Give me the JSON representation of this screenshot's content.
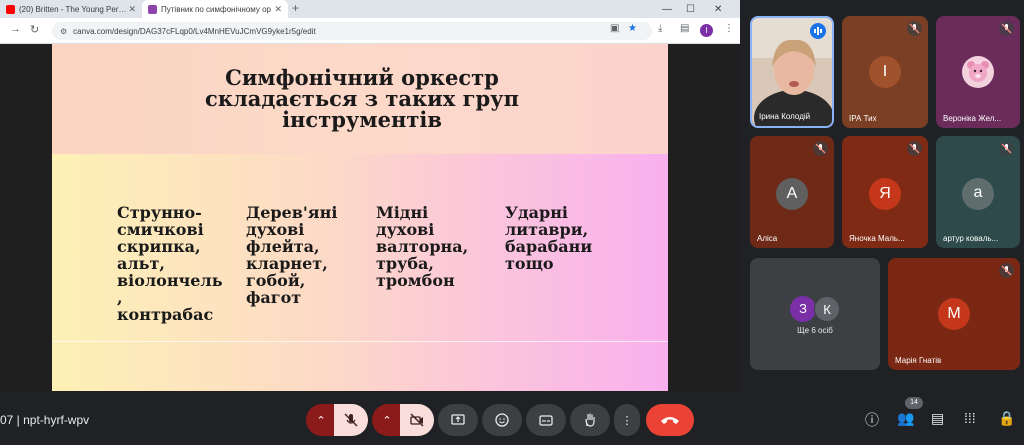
{
  "browser": {
    "tabs": [
      {
        "label": "(20) Britten - The Young Person's",
        "favicon_color": "#ff0000"
      },
      {
        "label": "Путівник по симфонічному ор",
        "favicon_color": "#8e44ad"
      }
    ],
    "new_tab": "+",
    "url": "canva.com/design/DAG37cFLqp0/Lv4MnHEVuJCmVG9yke1r5g/edit",
    "profile_initial": "I"
  },
  "slide": {
    "title": "Симфонічний оркестр складається з таких груп інструментів",
    "columns": [
      {
        "text": "Струнно-\nсмичкові\nскрипка,\nальт,\nвіолончель\n,\nконтрабас"
      },
      {
        "text": "Дерев'яні\nдухові\nфлейта,\nкларнет,\nгобой,\nфагот"
      },
      {
        "text": "Мідні\nдухові\nвалторна,\nтруба,\nтромбон"
      },
      {
        "text": "Ударні\nлитаври,\nбарабани\nтощо"
      }
    ]
  },
  "participants": [
    {
      "name": "Ірина Колодій",
      "type": "video"
    },
    {
      "name": "ІРА Тих",
      "initial": "І",
      "tile_color": "#7a3f24",
      "avatar_color": "#a0522d"
    },
    {
      "name": "Вероніка Жел...",
      "tile_color": "#6b2c5b"
    },
    {
      "name": "Аліса",
      "initial": "A",
      "tile_color": "#6e2a16",
      "avatar_color": "#5f5f5f"
    },
    {
      "name": "Яночка Маль...",
      "initial": "Я",
      "tile_color": "#7e2a14",
      "avatar_color": "#c5371b"
    },
    {
      "name": "артур коваль...",
      "initial": "a",
      "tile_color": "#2f4a4a",
      "avatar_color": "#5f6d6d"
    },
    {
      "name": "Марія Гнатів",
      "initial": "М",
      "tile_color": "#7a2813",
      "avatar_color": "#c5371b"
    }
  ],
  "others": {
    "label": "Ще 6 осіб",
    "initials": [
      "З",
      "К"
    ],
    "colors": [
      "#7b2fa6",
      "#5f6368"
    ]
  },
  "bottom": {
    "meeting_code": "07 | npt-hyrf-wpv",
    "participant_count": "14"
  }
}
